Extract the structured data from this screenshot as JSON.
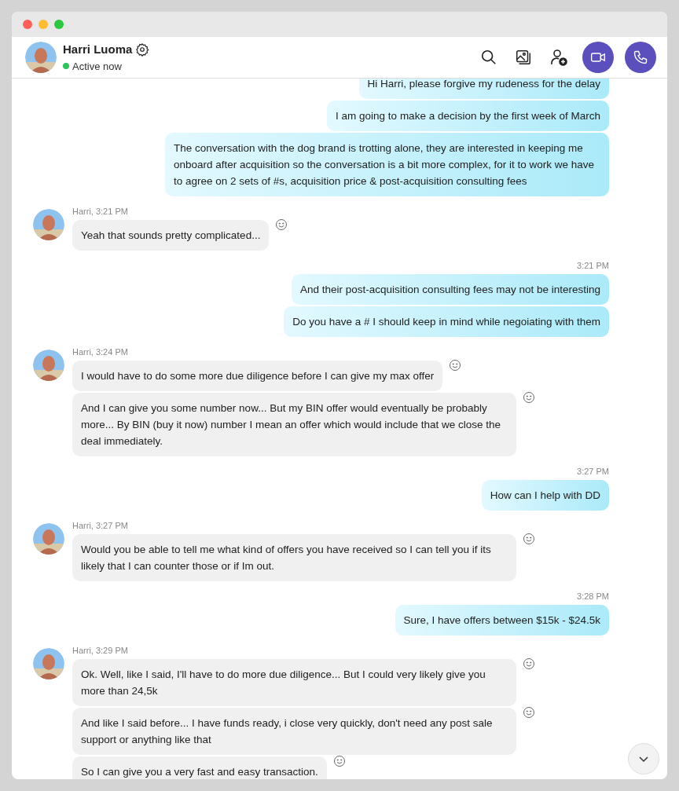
{
  "contact": {
    "name": "Harri Luoma",
    "status": "Active now",
    "online": true
  },
  "groups": [
    {
      "kind": "outgoing",
      "messages": [
        "Hi Harri, please forgive my rudeness for the delay",
        "I am going to make a decision by the first week of March",
        "The conversation with the dog brand is trotting alone, they are interested in keeping me onboard after acquisition so the conversation is a bit more complex, for it to work we have to agree on 2 sets of #s, acquisition price & post-acquisition consulting fees"
      ]
    },
    {
      "kind": "incoming",
      "meta": "Harri, 3:21 PM",
      "messages": [
        "Yeah that sounds pretty complicated..."
      ]
    },
    {
      "kind": "outgoing",
      "meta": "3:21 PM",
      "messages": [
        "And their post-acquisition consulting fees may not be interesting",
        "Do you have a # I should keep in mind while negoiating with them"
      ]
    },
    {
      "kind": "incoming",
      "meta": "Harri, 3:24 PM",
      "messages": [
        "I would have to do some more due diligence before I can give my max offer",
        "And I can give you some number now... But my BIN offer would eventually be probably more... By BIN (buy it now) number I mean an offer which would include that we close the deal immediately."
      ]
    },
    {
      "kind": "outgoing",
      "meta": "3:27 PM",
      "messages": [
        "How can I help with DD"
      ]
    },
    {
      "kind": "incoming",
      "meta": "Harri, 3:27 PM",
      "messages": [
        "Would you be able to tell me what kind of offers you have received so I can tell you if its likely that I can counter those or if Im out."
      ]
    },
    {
      "kind": "outgoing",
      "meta": "3:28 PM",
      "messages": [
        "Sure, I have offers between $15k - $24.5k"
      ]
    },
    {
      "kind": "incoming",
      "meta": "Harri, 3:29 PM",
      "messages": [
        "Ok. Well, like I said, I'll have to do more due diligence... But I could very likely give you more than 24,5k",
        "And like I said before... I have funds ready, i close very quickly, don't need any post sale support or anything like that",
        "So I can give you a very fast and easy transaction."
      ]
    }
  ]
}
